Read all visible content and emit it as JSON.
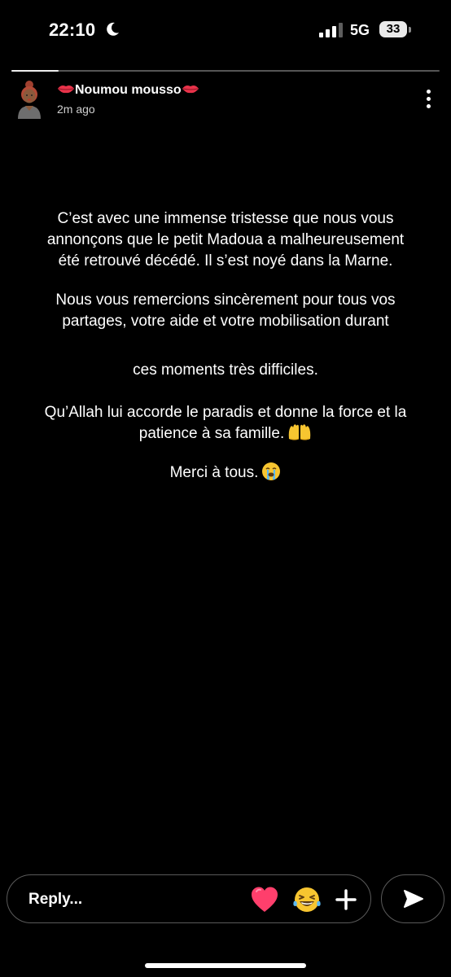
{
  "status_bar": {
    "time": "22:10",
    "network": "5G",
    "battery": "33",
    "icons": [
      "moon-icon",
      "signal-icon",
      "battery-icon"
    ]
  },
  "story": {
    "progress_fraction": 0.11,
    "user_name": "Noumou mousso",
    "name_decoration": "lips-emoji",
    "time_ago": "2m ago",
    "lines": [
      "C’est avec une immense tristesse que nous vous",
      "annonçons que le petit Madoua a malheureusement",
      "été retrouvé décédé. Il s’est noyé dans la Marne.",
      "Nous vous remercions sincèrement pour tous vos",
      "partages, votre aide et votre mobilisation durant",
      "ces moments très difficiles.",
      "Qu’Allah lui accorde le paradis et donne la force et la",
      "patience à sa famille.",
      "Merci à tous."
    ],
    "emojis": {
      "line_8": "palms-up-together-emoji",
      "line_9": "loudly-crying-face-emoji"
    }
  },
  "reply_bar": {
    "placeholder": "Reply...",
    "reactions": [
      "heart-icon",
      "laughing-face-icon"
    ],
    "add_icon": "plus-icon",
    "send_icon": "send-icon"
  },
  "colors": {
    "background": "#000000",
    "text": "#ffffff",
    "heart": "#ff3f6c"
  }
}
